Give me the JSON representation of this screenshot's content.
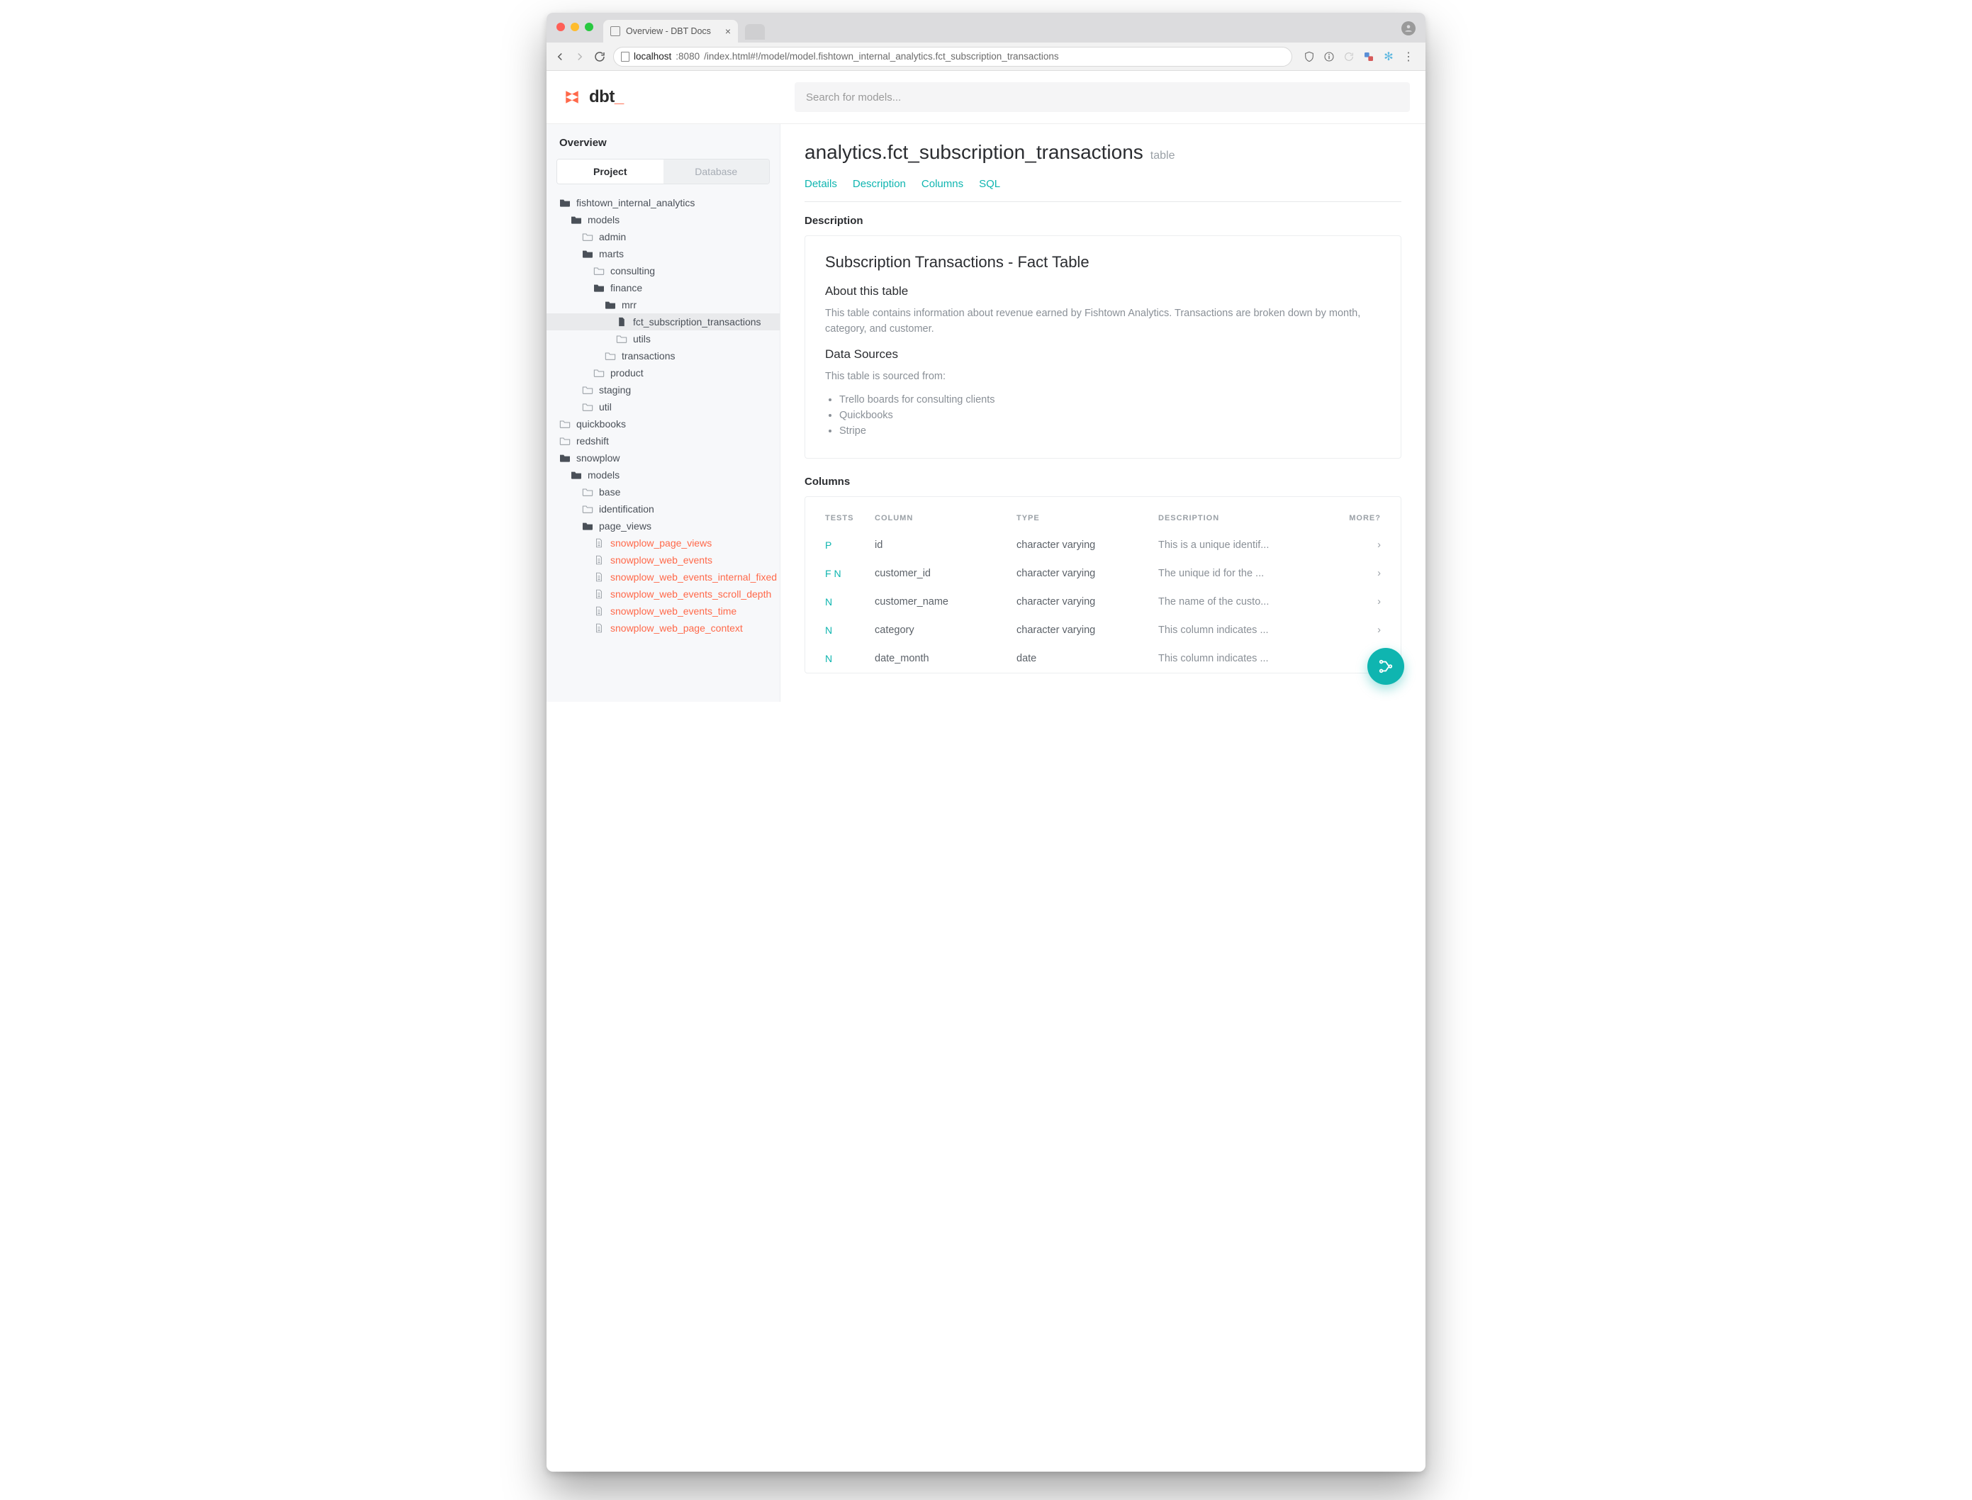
{
  "browser": {
    "tab_title": "Overview - DBT Docs",
    "url_host": "localhost",
    "url_port": ":8080",
    "url_path": "/index.html#!/model/model.fishtown_internal_analytics.fct_subscription_transactions"
  },
  "app": {
    "logo_text": "dbt",
    "search_placeholder": "Search for models..."
  },
  "sidebar": {
    "heading": "Overview",
    "segments": {
      "project": "Project",
      "database": "Database"
    },
    "tree": [
      {
        "label": "fishtown_internal_analytics",
        "depth": 0,
        "icon": "folder-open"
      },
      {
        "label": "models",
        "depth": 1,
        "icon": "folder-open"
      },
      {
        "label": "admin",
        "depth": 2,
        "icon": "folder"
      },
      {
        "label": "marts",
        "depth": 2,
        "icon": "folder-open"
      },
      {
        "label": "consulting",
        "depth": 3,
        "icon": "folder"
      },
      {
        "label": "finance",
        "depth": 3,
        "icon": "folder-open"
      },
      {
        "label": "mrr",
        "depth": 4,
        "icon": "folder-open"
      },
      {
        "label": "fct_subscription_transactions",
        "depth": 5,
        "icon": "file-solid",
        "selected": true
      },
      {
        "label": "utils",
        "depth": 5,
        "icon": "folder"
      },
      {
        "label": "transactions",
        "depth": 4,
        "icon": "folder"
      },
      {
        "label": "product",
        "depth": 3,
        "icon": "folder"
      },
      {
        "label": "staging",
        "depth": 2,
        "icon": "folder"
      },
      {
        "label": "util",
        "depth": 2,
        "icon": "folder"
      },
      {
        "label": "quickbooks",
        "depth": 0,
        "icon": "folder"
      },
      {
        "label": "redshift",
        "depth": 0,
        "icon": "folder"
      },
      {
        "label": "snowplow",
        "depth": 0,
        "icon": "folder-open"
      },
      {
        "label": "models",
        "depth": 1,
        "icon": "folder-open"
      },
      {
        "label": "base",
        "depth": 2,
        "icon": "folder"
      },
      {
        "label": "identification",
        "depth": 2,
        "icon": "folder"
      },
      {
        "label": "page_views",
        "depth": 2,
        "icon": "folder-open"
      },
      {
        "label": "snowplow_page_views",
        "depth": 3,
        "icon": "file",
        "red": true
      },
      {
        "label": "snowplow_web_events",
        "depth": 3,
        "icon": "file",
        "red": true
      },
      {
        "label": "snowplow_web_events_internal_fixed",
        "depth": 3,
        "icon": "file",
        "red": true
      },
      {
        "label": "snowplow_web_events_scroll_depth",
        "depth": 3,
        "icon": "file",
        "red": true
      },
      {
        "label": "snowplow_web_events_time",
        "depth": 3,
        "icon": "file",
        "red": true
      },
      {
        "label": "snowplow_web_page_context",
        "depth": 3,
        "icon": "file",
        "red": true
      }
    ]
  },
  "page": {
    "title": "analytics.fct_subscription_transactions",
    "kind": "table",
    "tabs": {
      "details": "Details",
      "description": "Description",
      "columns": "Columns",
      "sql": "SQL"
    },
    "desc_section_label": "Description",
    "desc": {
      "h1": "Subscription Transactions - Fact Table",
      "about_h": "About this table",
      "about_p": "This table contains information about revenue earned by Fishtown Analytics. Transactions are broken down by month, category, and customer.",
      "sources_h": "Data Sources",
      "sources_p": "This table is sourced from:",
      "sources_list": [
        "Trello boards for consulting clients",
        "Quickbooks",
        "Stripe"
      ]
    },
    "columns_label": "Columns",
    "columns_head": {
      "tests": "TESTS",
      "column": "COLUMN",
      "type": "TYPE",
      "desc": "DESCRIPTION",
      "more": "MORE?"
    },
    "columns": [
      {
        "tests": "P",
        "name": "id",
        "type": "character varying",
        "desc": "This is a unique identif..."
      },
      {
        "tests": "F N",
        "name": "customer_id",
        "type": "character varying",
        "desc": "The unique id for the ..."
      },
      {
        "tests": "N",
        "name": "customer_name",
        "type": "character varying",
        "desc": "The name of the custo..."
      },
      {
        "tests": "N",
        "name": "category",
        "type": "character varying",
        "desc": "This column indicates ..."
      },
      {
        "tests": "N",
        "name": "date_month",
        "type": "date",
        "desc": "This column indicates ..."
      }
    ]
  }
}
